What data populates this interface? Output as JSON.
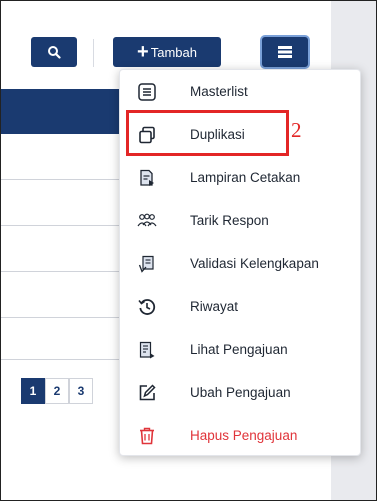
{
  "toolbar": {
    "add_label": "Tambah",
    "add_plus": "+"
  },
  "pagination": {
    "pages": [
      "1",
      "2",
      "3"
    ],
    "active_page": "1"
  },
  "menu": {
    "items": [
      {
        "label": "Masterlist",
        "icon": "list-icon"
      },
      {
        "label": "Duplikasi",
        "icon": "copy-icon"
      },
      {
        "label": "Lampiran Cetakan",
        "icon": "print-attachment-icon"
      },
      {
        "label": "Tarik Respon",
        "icon": "group-icon"
      },
      {
        "label": "Validasi Kelengkapan",
        "icon": "validate-doc-icon"
      },
      {
        "label": "Riwayat",
        "icon": "history-icon"
      },
      {
        "label": "Lihat Pengajuan",
        "icon": "view-doc-icon"
      },
      {
        "label": "Ubah Pengajuan",
        "icon": "edit-icon"
      },
      {
        "label": "Hapus Pengajuan",
        "icon": "trash-icon"
      }
    ]
  },
  "annotation": {
    "number": "2"
  },
  "colors": {
    "primary": "#1a3a70",
    "danger": "#e0343a",
    "highlight": "#e32626"
  }
}
